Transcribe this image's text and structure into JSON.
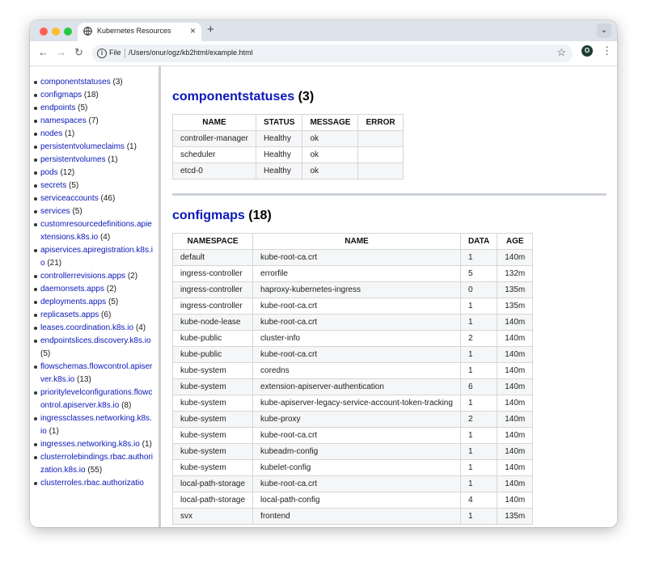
{
  "browser": {
    "tab_title": "Kubernetes Resources",
    "tab_close": "×",
    "new_tab": "+",
    "tab_menu": "⌄",
    "back": "←",
    "forward": "→",
    "reload": "↻",
    "info": "i",
    "scheme_label": "File",
    "url": "/Users/onur/ogz/kb2html/example.html",
    "bookmark": "☆",
    "profile_initial": "O",
    "menu": "⋮"
  },
  "sidebar": {
    "items": [
      {
        "name": "componentstatuses",
        "count": "(3)"
      },
      {
        "name": "configmaps",
        "count": "(18)"
      },
      {
        "name": "endpoints",
        "count": "(5)"
      },
      {
        "name": "namespaces",
        "count": "(7)"
      },
      {
        "name": "nodes",
        "count": "(1)"
      },
      {
        "name": "persistentvolumeclaims",
        "count": "(1)"
      },
      {
        "name": "persistentvolumes",
        "count": "(1)"
      },
      {
        "name": "pods",
        "count": "(12)"
      },
      {
        "name": "secrets",
        "count": "(5)"
      },
      {
        "name": "serviceaccounts",
        "count": "(46)"
      },
      {
        "name": "services",
        "count": "(5)"
      },
      {
        "name": "customresourcedefinitions.apiextensions.k8s.io",
        "count": "(4)"
      },
      {
        "name": "apiservices.apiregistration.k8s.io",
        "count": "(21)"
      },
      {
        "name": "controllerrevisions.apps",
        "count": "(2)"
      },
      {
        "name": "daemonsets.apps",
        "count": "(2)"
      },
      {
        "name": "deployments.apps",
        "count": "(5)"
      },
      {
        "name": "replicasets.apps",
        "count": "(6)"
      },
      {
        "name": "leases.coordination.k8s.io",
        "count": "(4)"
      },
      {
        "name": "endpointslices.discovery.k8s.io",
        "count": "(5)"
      },
      {
        "name": "flowschemas.flowcontrol.apiserver.k8s.io",
        "count": "(13)"
      },
      {
        "name": "prioritylevelconfigurations.flowcontrol.apiserver.k8s.io",
        "count": "(8)"
      },
      {
        "name": "ingressclasses.networking.k8s.io",
        "count": "(1)"
      },
      {
        "name": "ingresses.networking.k8s.io",
        "count": "(1)"
      },
      {
        "name": "clusterrolebindings.rbac.authorization.k8s.io",
        "count": "(55)"
      },
      {
        "name": "clusterroles.rbac.authorizatio",
        "count": ""
      }
    ]
  },
  "componentstatuses": {
    "title": "componentstatuses",
    "count": "(3)",
    "headers": [
      "NAME",
      "STATUS",
      "MESSAGE",
      "ERROR"
    ],
    "rows": [
      [
        "controller-manager",
        "Healthy",
        "ok",
        ""
      ],
      [
        "scheduler",
        "Healthy",
        "ok",
        ""
      ],
      [
        "etcd-0",
        "Healthy",
        "ok",
        ""
      ]
    ]
  },
  "configmaps": {
    "title": "configmaps",
    "count": "(18)",
    "headers": [
      "NAMESPACE",
      "NAME",
      "DATA",
      "AGE"
    ],
    "rows": [
      [
        "default",
        "kube-root-ca.crt",
        "1",
        "140m"
      ],
      [
        "ingress-controller",
        "errorfile",
        "5",
        "132m"
      ],
      [
        "ingress-controller",
        "haproxy-kubernetes-ingress",
        "0",
        "135m"
      ],
      [
        "ingress-controller",
        "kube-root-ca.crt",
        "1",
        "135m"
      ],
      [
        "kube-node-lease",
        "kube-root-ca.crt",
        "1",
        "140m"
      ],
      [
        "kube-public",
        "cluster-info",
        "2",
        "140m"
      ],
      [
        "kube-public",
        "kube-root-ca.crt",
        "1",
        "140m"
      ],
      [
        "kube-system",
        "coredns",
        "1",
        "140m"
      ],
      [
        "kube-system",
        "extension-apiserver-authentication",
        "6",
        "140m"
      ],
      [
        "kube-system",
        "kube-apiserver-legacy-service-account-token-tracking",
        "1",
        "140m"
      ],
      [
        "kube-system",
        "kube-proxy",
        "2",
        "140m"
      ],
      [
        "kube-system",
        "kube-root-ca.crt",
        "1",
        "140m"
      ],
      [
        "kube-system",
        "kubeadm-config",
        "1",
        "140m"
      ],
      [
        "kube-system",
        "kubelet-config",
        "1",
        "140m"
      ],
      [
        "local-path-storage",
        "kube-root-ca.crt",
        "1",
        "140m"
      ],
      [
        "local-path-storage",
        "local-path-config",
        "4",
        "140m"
      ],
      [
        "svx",
        "frontend",
        "1",
        "135m"
      ]
    ]
  }
}
